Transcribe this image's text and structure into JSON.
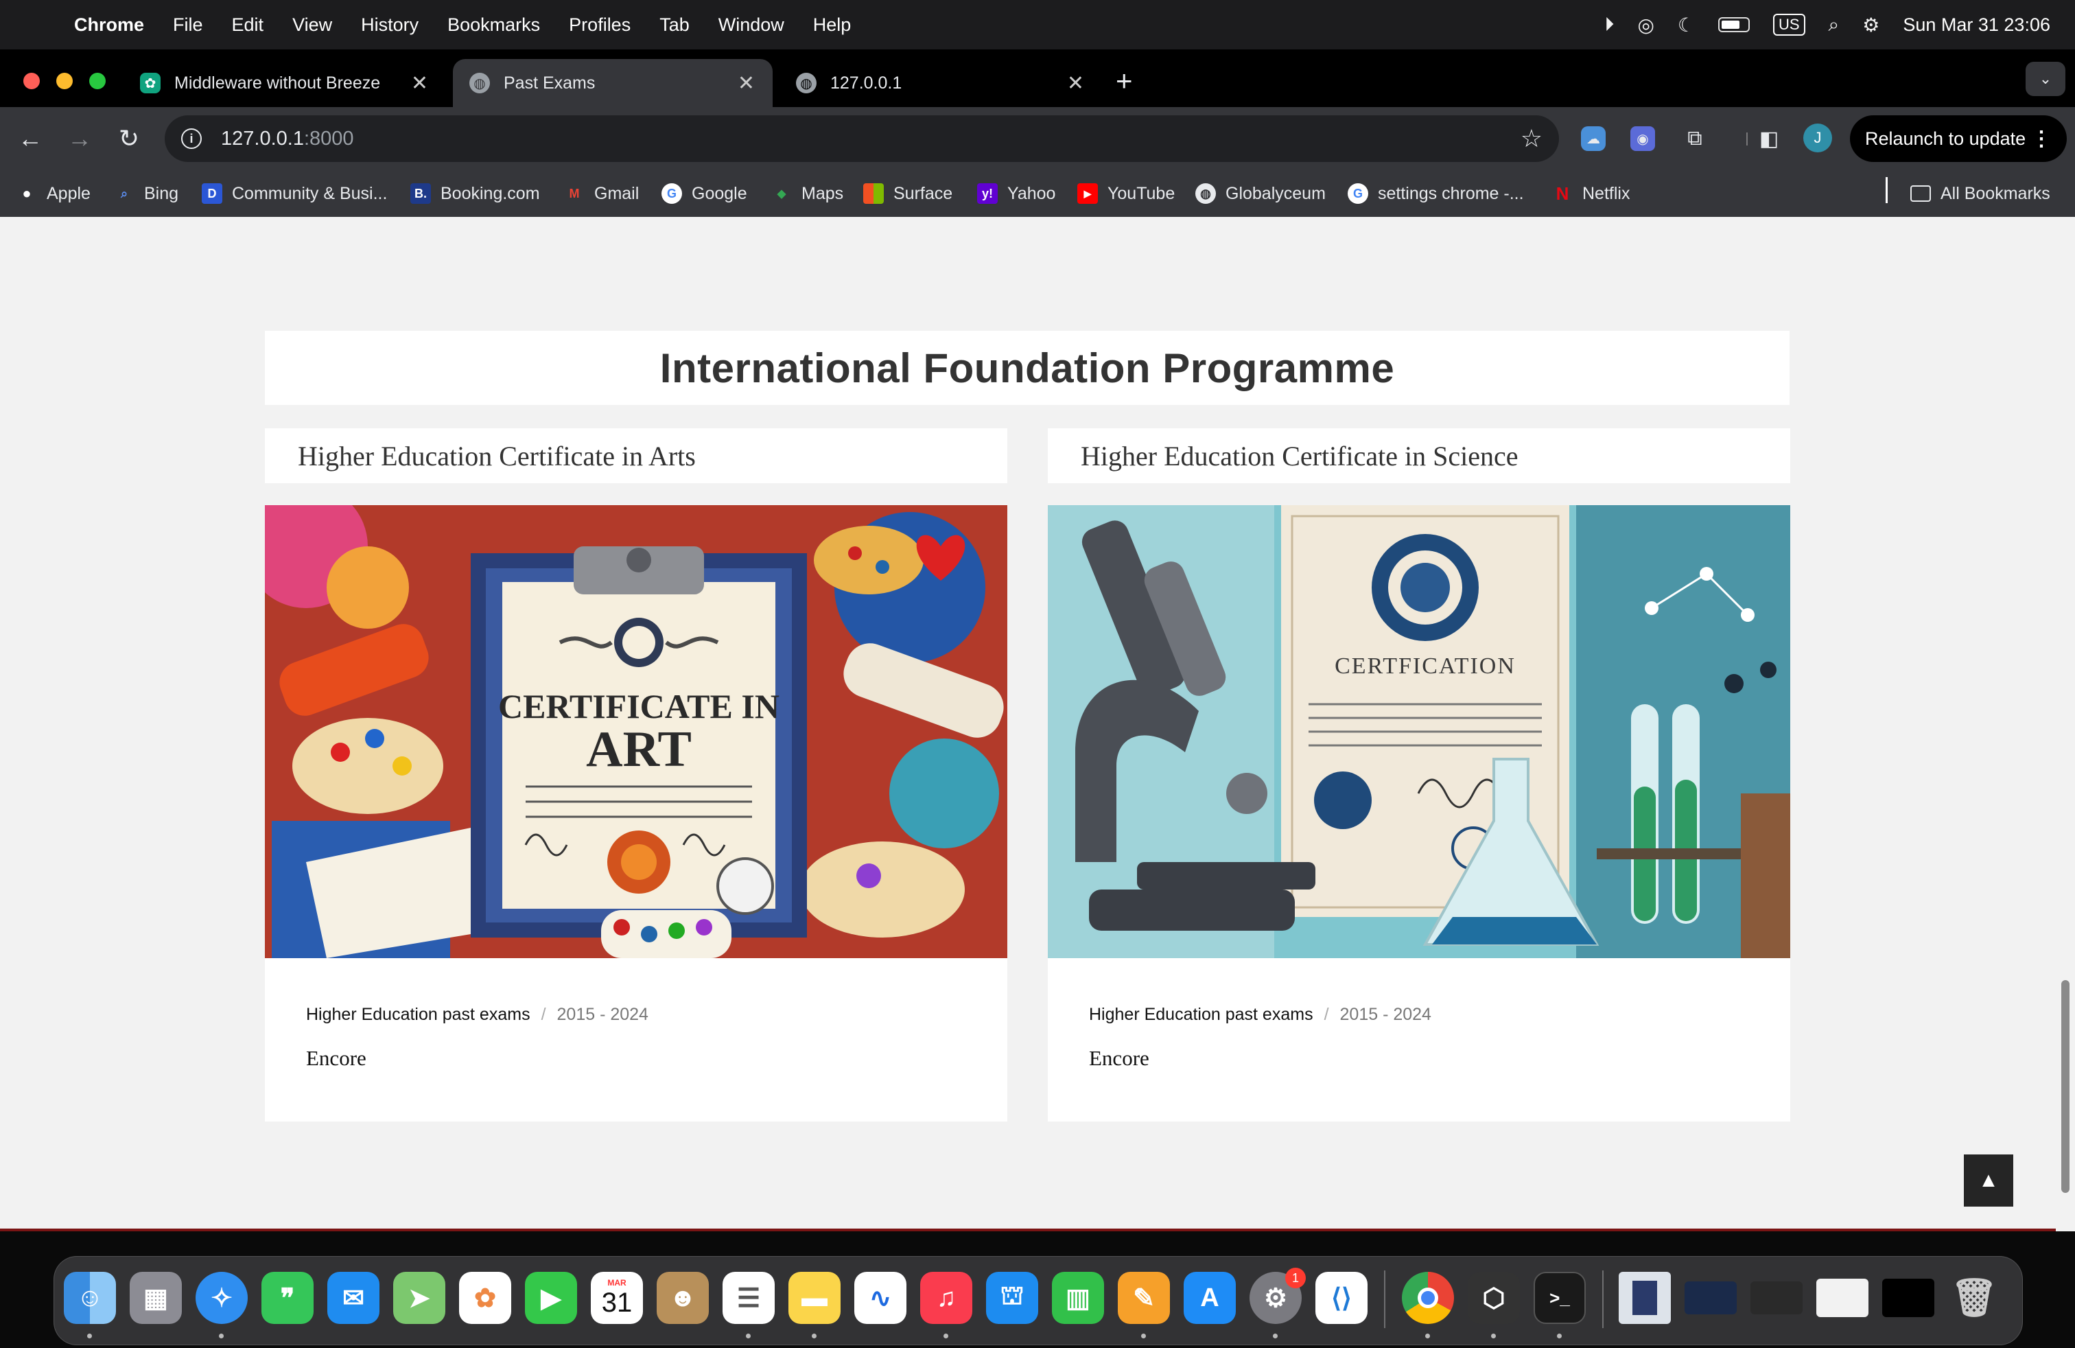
{
  "menubar": {
    "app_name": "Chrome",
    "menus": [
      "File",
      "Edit",
      "View",
      "History",
      "Bookmarks",
      "Profiles",
      "Tab",
      "Window",
      "Help"
    ],
    "input_source": "US",
    "datetime": "Sun Mar 31  23:06"
  },
  "tabs": [
    {
      "title": "Middleware without Breeze",
      "icon": "chatgpt-icon",
      "active": false
    },
    {
      "title": "Past Exams",
      "icon": "globe-icon",
      "active": true
    },
    {
      "title": "127.0.0.1",
      "icon": "globe-icon",
      "active": false
    }
  ],
  "toolbar": {
    "url_host": "127.0.0.1",
    "url_port": ":8000",
    "relaunch_label": "Relaunch to update",
    "avatar_initial": "J"
  },
  "bookmarks": {
    "items": [
      {
        "label": "Apple",
        "icon": "apple-icon"
      },
      {
        "label": "Bing",
        "icon": "bing-search-icon"
      },
      {
        "label": "Community & Busi...",
        "icon": "community-icon"
      },
      {
        "label": "Booking.com",
        "icon": "booking-icon"
      },
      {
        "label": "Gmail",
        "icon": "gmail-icon"
      },
      {
        "label": "Google",
        "icon": "google-icon"
      },
      {
        "label": "Maps",
        "icon": "maps-icon"
      },
      {
        "label": "Surface",
        "icon": "microsoft-icon"
      },
      {
        "label": "Yahoo",
        "icon": "yahoo-icon"
      },
      {
        "label": "YouTube",
        "icon": "youtube-icon"
      },
      {
        "label": "Globalyceum",
        "icon": "globe-icon"
      },
      {
        "label": "settings chrome -...",
        "icon": "google-icon"
      },
      {
        "label": "Netflix",
        "icon": "netflix-icon"
      }
    ],
    "all_bookmarks_label": "All Bookmarks"
  },
  "page": {
    "heading": "International Foundation Programme",
    "cards": [
      {
        "title": "Higher Education Certificate in Arts",
        "image_caption_line1": "CERTIFICATE IN",
        "image_caption_line2": "ART",
        "breadcrumb_link": "Higher Education past exams",
        "years": "2015 - 2024",
        "tag": "Encore"
      },
      {
        "title": "Higher Education Certificate in Science",
        "image_caption_line1": "CERTFICATION",
        "breadcrumb_link": "Higher Education past exams",
        "years": "2015 - 2024",
        "tag": "Encore"
      }
    ]
  },
  "dock": {
    "apps": [
      "Finder",
      "Launchpad",
      "Safari",
      "Messages",
      "Mail",
      "Maps",
      "Photos",
      "FaceTime",
      "Calendar",
      "Contacts",
      "Reminders",
      "Notes",
      "Freeform",
      "Music",
      "Keynote",
      "Numbers",
      "Pages",
      "App Store",
      "System Settings",
      "Visual Studio Code",
      "Google Chrome",
      "Unity Hub",
      "Terminal"
    ],
    "calendar_month": "MAR",
    "calendar_day": "31",
    "settings_badge": "1"
  },
  "colors": {
    "page_bg": "#f2f2f2",
    "footer_accent": "#7a1414",
    "chrome_toolbar": "#35363a"
  }
}
